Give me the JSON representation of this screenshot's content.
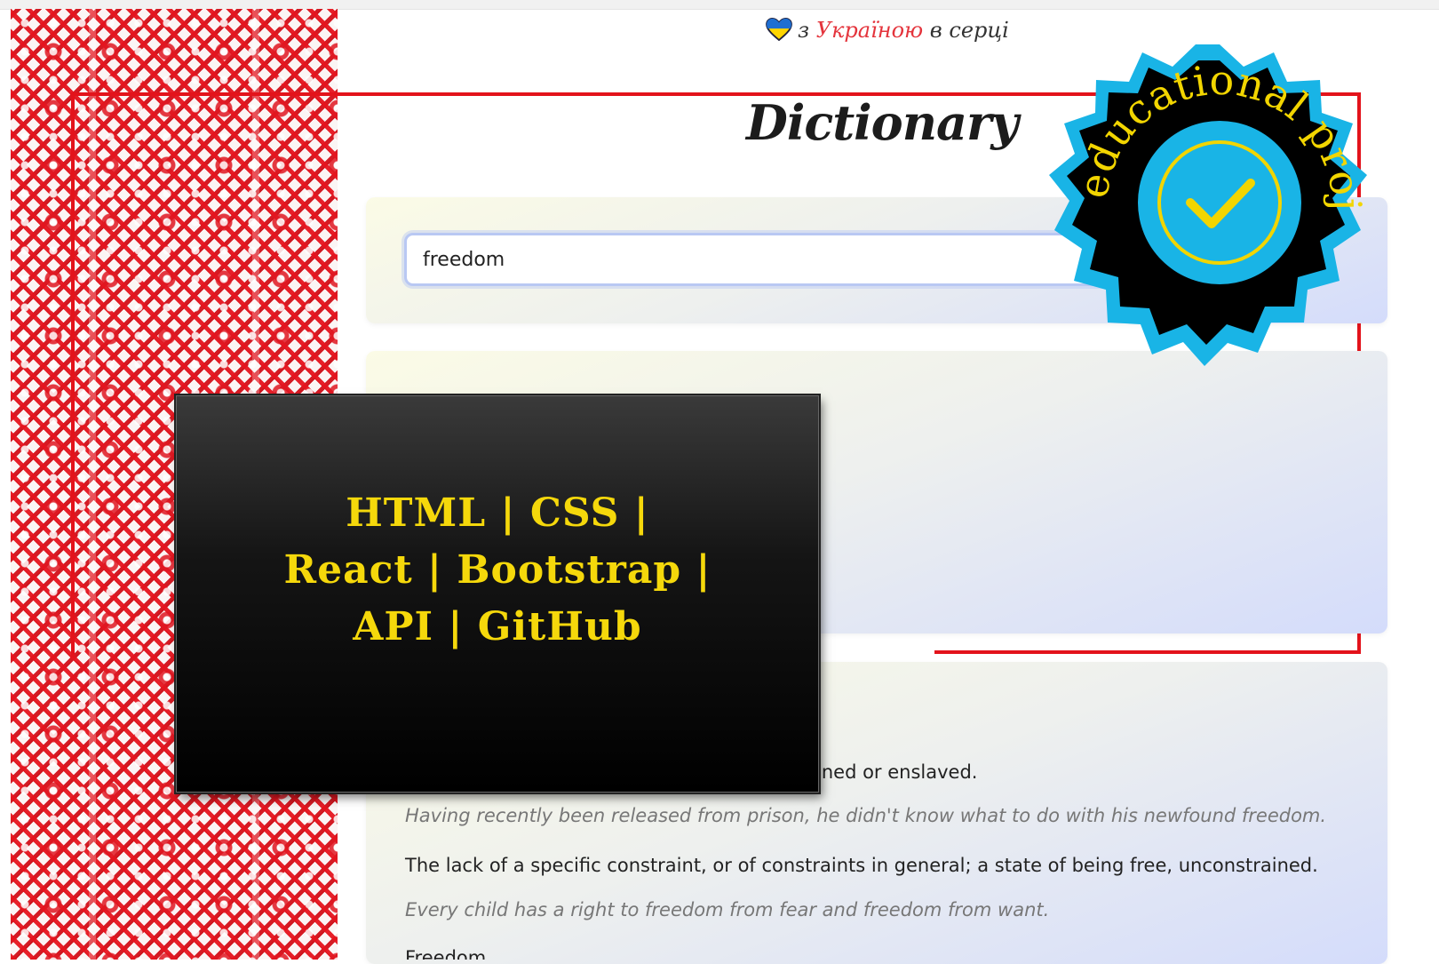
{
  "header": {
    "tagline_prefix": "з",
    "tagline_highlight": "Україною",
    "tagline_suffix": "в серці"
  },
  "app": {
    "title": "Dictionary"
  },
  "search": {
    "value": "freedom"
  },
  "definitions": {
    "fragment": "oned or enslaved.",
    "example_1": "Having recently been released from prison, he didn't know what to do with his newfound freedom.",
    "definition_2": "The lack of a specific constraint, or of constraints in general; a state of being free, unconstrained.",
    "example_2": "Every child has a right to freedom from fear and freedom from want.",
    "definition_3_partial": "Freedom …"
  },
  "overlay": {
    "line_1": "HTML | CSS |",
    "line_2": "React | Bootstrap |",
    "line_3": "API | GitHub"
  },
  "badge": {
    "text": "educational project"
  },
  "colors": {
    "accent_red": "#e3131b",
    "ukraine_text": "#e4343c",
    "tech_text": "#f5d80b",
    "badge_blue": "#19b4e6",
    "badge_black": "#000000"
  },
  "icons": [
    "heart-icon",
    "checkmark-icon"
  ]
}
